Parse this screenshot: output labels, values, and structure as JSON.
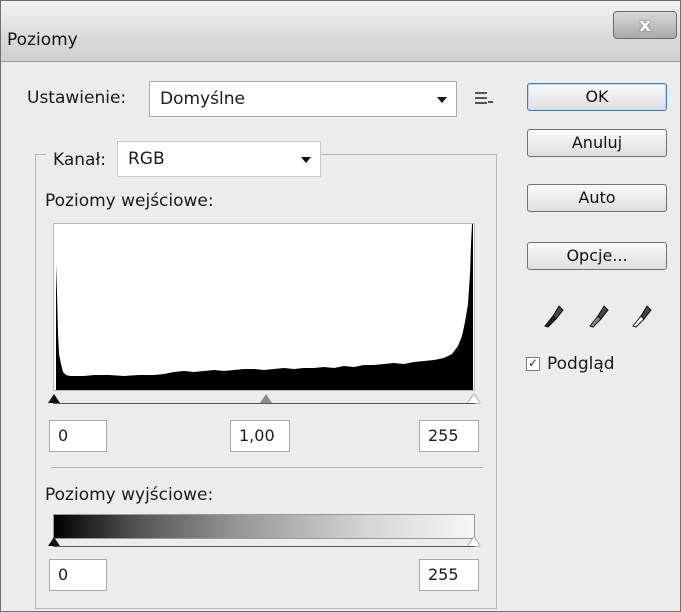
{
  "window": {
    "title": "Poziomy",
    "close_label": "x"
  },
  "preset": {
    "label": "Ustawienie:",
    "value": "Domyślne",
    "menu_icon": "list-menu-icon"
  },
  "channel": {
    "label": "Kanał:",
    "value": "RGB"
  },
  "input_levels": {
    "label": "Poziomy wejściowe:",
    "black": "0",
    "gamma": "1,00",
    "white": "255"
  },
  "output_levels": {
    "label": "Poziomy wyjściowe:",
    "black": "0",
    "white": "255"
  },
  "buttons": {
    "ok": "OK",
    "cancel": "Anuluj",
    "auto": "Auto",
    "options": "Opcje..."
  },
  "eyedroppers": [
    "black-point-eyedropper-icon",
    "gray-point-eyedropper-icon",
    "white-point-eyedropper-icon"
  ],
  "preview": {
    "label": "Podgląd",
    "checked": true
  }
}
